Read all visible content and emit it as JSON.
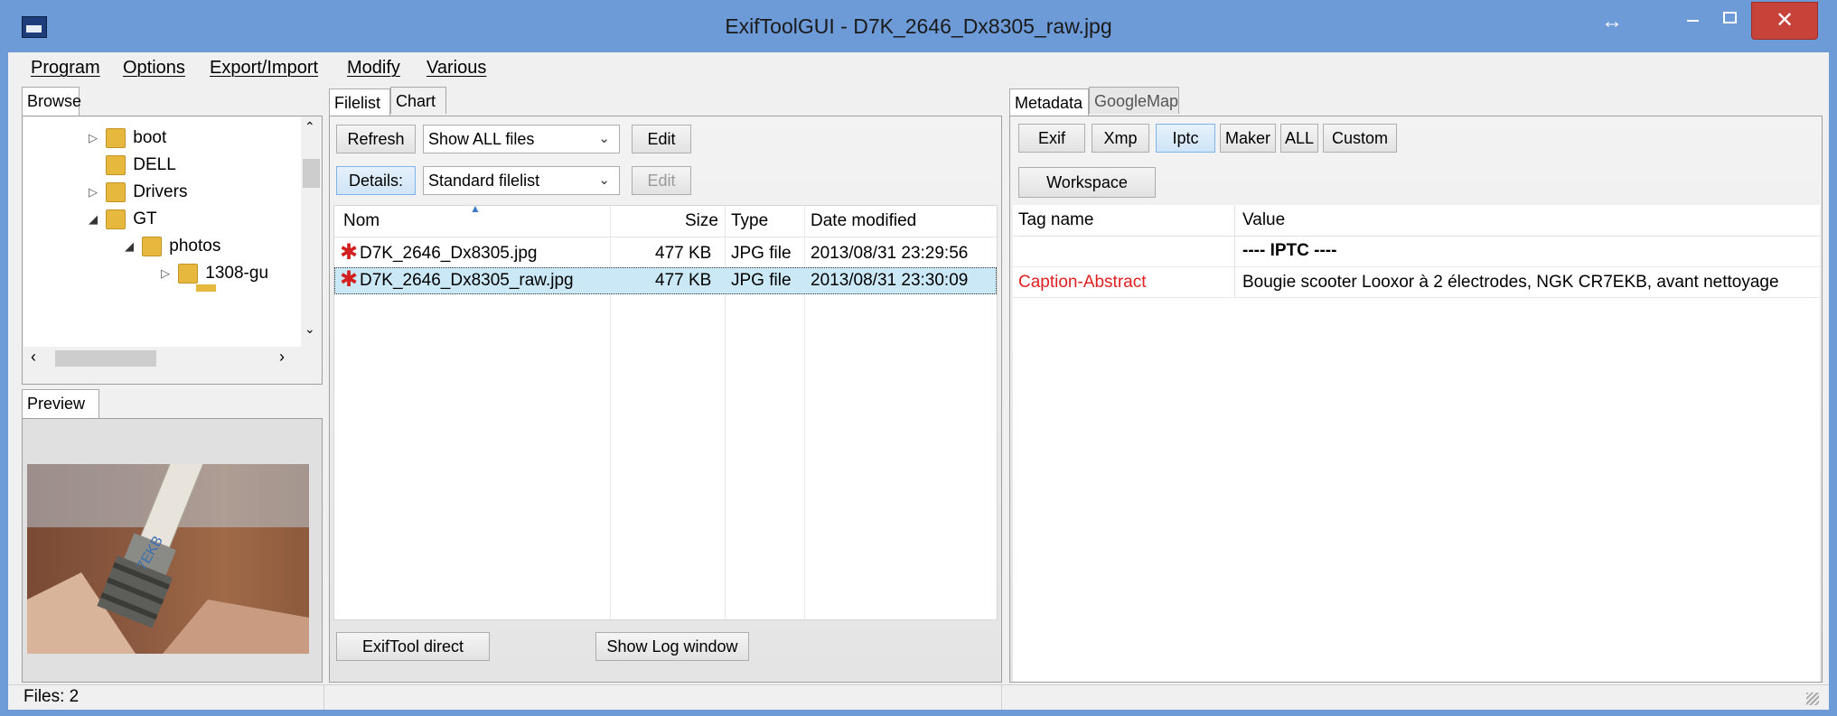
{
  "window": {
    "title": "ExifToolGUI - D7K_2646_Dx8305_raw.jpg",
    "resize_glyph": "↔",
    "close_glyph": "✕",
    "accent": "#6d9bd8"
  },
  "menu": [
    "Program",
    "Options",
    "Export/Import",
    "Modify",
    "Various"
  ],
  "browse": {
    "tab_label": "Browse",
    "tree": [
      {
        "label": "boot",
        "expander": "▷"
      },
      {
        "label": "DELL",
        "expander": ""
      },
      {
        "label": "Drivers",
        "expander": "▷"
      },
      {
        "label": "GT",
        "expander": "◢"
      },
      {
        "label": "photos",
        "expander": "◢"
      },
      {
        "label": "1308-gu",
        "expander": "▷"
      }
    ]
  },
  "preview": {
    "tab_label": "Preview"
  },
  "filelist": {
    "tabs": [
      "Filelist",
      "Chart"
    ],
    "refresh_label": "Refresh",
    "show_select": "Show ALL files",
    "edit_label": "Edit",
    "details_label": "Details:",
    "filelist_select": "Standard filelist",
    "edit2_label": "Edit",
    "columns": {
      "name": "Nom",
      "size": "Size",
      "type": "Type",
      "date": "Date modified"
    },
    "rows": [
      {
        "name": "D7K_2646_Dx8305.jpg",
        "size": "477 KB",
        "type": "JPG file",
        "date": "2013/08/31 23:29:56"
      },
      {
        "name": "D7K_2646_Dx8305_raw.jpg",
        "size": "477 KB",
        "type": "JPG file",
        "date": "2013/08/31 23:30:09"
      }
    ],
    "exiftool_direct_label": "ExifTool direct",
    "show_log_label": "Show Log window"
  },
  "metadata": {
    "tabs": [
      "Metadata",
      "GoogleMap"
    ],
    "buttons": [
      "Exif",
      "Xmp",
      "Iptc",
      "Maker",
      "ALL",
      "Custom"
    ],
    "workspace_label": "Workspace",
    "columns": {
      "tag": "Tag name",
      "value": "Value"
    },
    "section_label": "---- IPTC ----",
    "rows": [
      {
        "tag": "Caption-Abstract",
        "value": "Bougie scooter Looxor à 2 électrodes, NGK CR7EKB, avant nettoyage"
      }
    ]
  },
  "status": {
    "files": "Files: 2"
  },
  "colors": {
    "tag_red": "#e02020",
    "selection": "#cbe8f6"
  }
}
